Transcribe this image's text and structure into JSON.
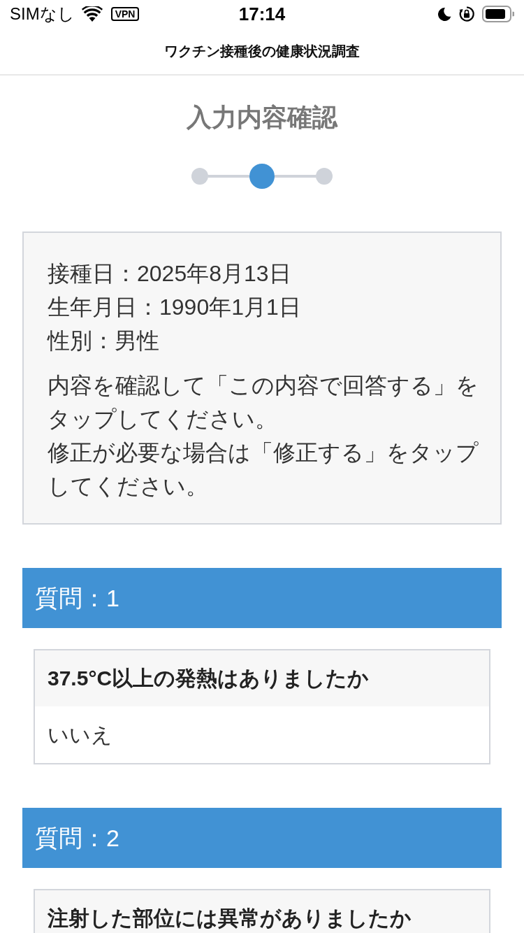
{
  "status_bar": {
    "carrier": "SIMなし",
    "vpn": "VPN",
    "time": "17:14"
  },
  "nav": {
    "title": "ワクチン接種後の健康状況調査"
  },
  "page_title": "入力内容確認",
  "steps": [
    {
      "selected": false
    },
    {
      "selected": true
    },
    {
      "selected": false
    }
  ],
  "summary": {
    "lines": [
      "接種日：2025年8月13日",
      "生年月日：1990年1月1日",
      "性別：男性"
    ],
    "instructions": [
      "内容を確認して「この内容で回答する」をタップしてください。",
      "修正が必要な場合は「修正する」をタップしてください。"
    ]
  },
  "questions": [
    {
      "heading": "質問：1",
      "question": "37.5°C以上の発熱はありましたか",
      "answer": "いいえ"
    },
    {
      "heading": "質問：2",
      "question": "注射した部位には異常がありましたか"
    }
  ]
}
